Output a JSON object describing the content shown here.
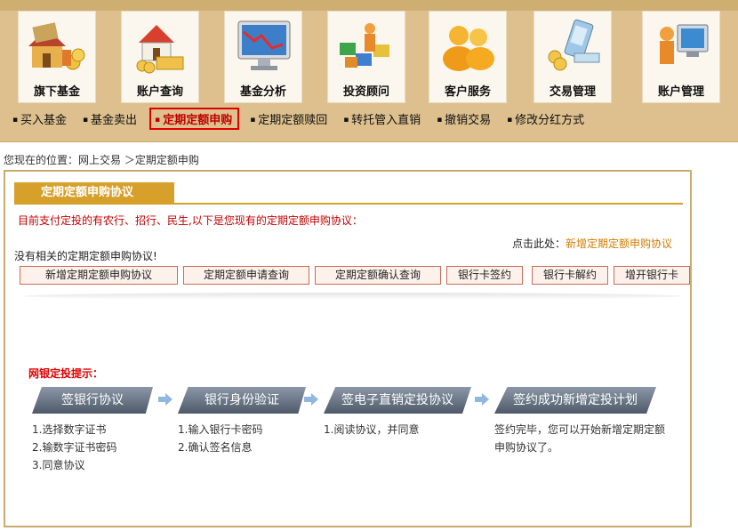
{
  "modules": [
    {
      "label": "旗下基金",
      "icon": "house-money-icon"
    },
    {
      "label": "账户查询",
      "icon": "house-coins-icon"
    },
    {
      "label": "基金分析",
      "icon": "monitor-chart-icon"
    },
    {
      "label": "投资顾问",
      "icon": "advisor-blocks-icon"
    },
    {
      "label": "客户服务",
      "icon": "people-icon"
    },
    {
      "label": "交易管理",
      "icon": "phone-coins-icon"
    },
    {
      "label": "账户管理",
      "icon": "person-computer-icon"
    }
  ],
  "subnav": [
    {
      "label": "买入基金",
      "active": false
    },
    {
      "label": "基金卖出",
      "active": false
    },
    {
      "label": "定期定额申购",
      "active": true
    },
    {
      "label": "定期定额赎回",
      "active": false
    },
    {
      "label": "转托管入直销",
      "active": false
    },
    {
      "label": "撤销交易",
      "active": false
    },
    {
      "label": "修改分红方式",
      "active": false
    }
  ],
  "breadcrumb": "您现在的位置：网上交易 ＞定期定额申购",
  "panel": {
    "title": "定期定额申购协议",
    "notice": "目前支付定投的有农行、招行、民生,以下是您现有的定期定额申购协议：",
    "click_here_prefix": "点击此处：",
    "click_here_link": "新增定期定额申购协议",
    "no_agreement": "没有相关的定期定额申购协议!",
    "buttons": [
      "新增定期定额申购协议",
      "定期定额申请查询",
      "定期定额确认查询",
      "银行卡签约",
      "银行卡解约",
      "增开银行卡"
    ]
  },
  "tips": {
    "title": "网银定投提示：",
    "steps": [
      {
        "label": "签银行协议",
        "desc": [
          "1.选择数字证书",
          "2.输数字证书密码",
          "3.同意协议"
        ]
      },
      {
        "label": "银行身份验证",
        "desc": [
          "1.输入银行卡密码",
          "2.确认签名信息"
        ]
      },
      {
        "label": "签电子直销定投协议",
        "desc": [
          "1.阅读协议，并同意"
        ]
      },
      {
        "label": "签约成功新增定投计划",
        "desc": [
          "签约完毕，您可以开始新增定期定额",
          "申购协议了。"
        ]
      }
    ]
  },
  "colors": {
    "header_bg": "#ddc08e",
    "panel_border": "#c9ab6e",
    "title_bar": "#d6a02b",
    "active_border": "#e00000",
    "link": "#d27c00"
  }
}
